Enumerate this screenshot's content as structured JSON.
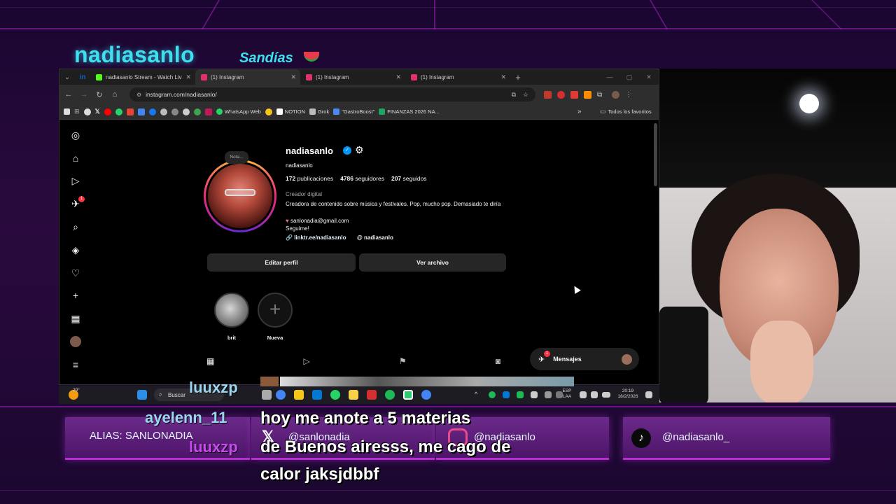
{
  "overlay": {
    "title": "nadiasanlo",
    "subtitle": "Sandías",
    "alias": "ALIAS: SANLONADIA",
    "x_handle": "@sanlonadia",
    "ig_handle": "@nadiasanlo",
    "tiktok_handle": "@nadiasanlo_",
    "chat": [
      {
        "user": "luuxzp"
      },
      {
        "user": "ayelenn_11",
        "message_lines": [
          "hoy me anote a 5 materias",
          "de Buenos airesss, me cago de",
          "calor jaksjdbbf"
        ]
      },
      {
        "user": "luuxzp"
      }
    ]
  },
  "browser": {
    "tabs": [
      {
        "label": "nadiasanlo Stream - Watch Liv",
        "icon": "kick-icon",
        "color": "#53fc18"
      },
      {
        "label": "(1) Instagram",
        "icon": "instagram-icon",
        "color": "#e1306c",
        "active": true
      },
      {
        "label": "(1) Instagram",
        "icon": "instagram-icon",
        "color": "#e1306c"
      },
      {
        "label": "(1) Instagram",
        "icon": "instagram-icon",
        "color": "#e1306c"
      }
    ],
    "url": "instagram.com/nadiasanlo/",
    "bookmarks": [
      {
        "label": "WhatsApp Web",
        "color": "#25d366"
      },
      {
        "label": "NOTION",
        "color": "#ffffff"
      },
      {
        "label": "Grok",
        "color": "#bbbbbb"
      },
      {
        "label": "\"GastroBoost\"",
        "color": "#4c8bf5"
      },
      {
        "label": "FINANZAS 2026 NA...",
        "color": "#1ea362"
      }
    ],
    "bookmarks_folder": "Todos los favoritos"
  },
  "instagram": {
    "note_label": "Nota...",
    "username": "nadiasanlo",
    "display_name": "nadiasanlo",
    "stats": {
      "posts": "172",
      "posts_label": "publicaciones",
      "followers": "4786",
      "followers_label": "seguidores",
      "following": "207",
      "following_label": "seguidos"
    },
    "category": "Creador digital",
    "bio": "Creadora de contenido sobre música y festivales. Pop, mucho pop. Demasiado te diría",
    "email": "sanlonadia@gmail.com",
    "follow_line": "Seguime!",
    "link": "linktr.ee/nadiasanlo",
    "threads": "nadiasanlo",
    "buttons": {
      "edit": "Editar perfil",
      "archive": "Ver archivo"
    },
    "highlights": [
      {
        "label": "brit"
      },
      {
        "label": "Nueva"
      }
    ],
    "notification_count": "1",
    "messages_label": "Mensajes",
    "messages_badge": "1"
  },
  "taskbar": {
    "weather": "29°",
    "search": "Buscar",
    "lang_top": "ESP",
    "lang_bottom": "LAA",
    "time": "20:19",
    "date": "18/2/2026"
  }
}
